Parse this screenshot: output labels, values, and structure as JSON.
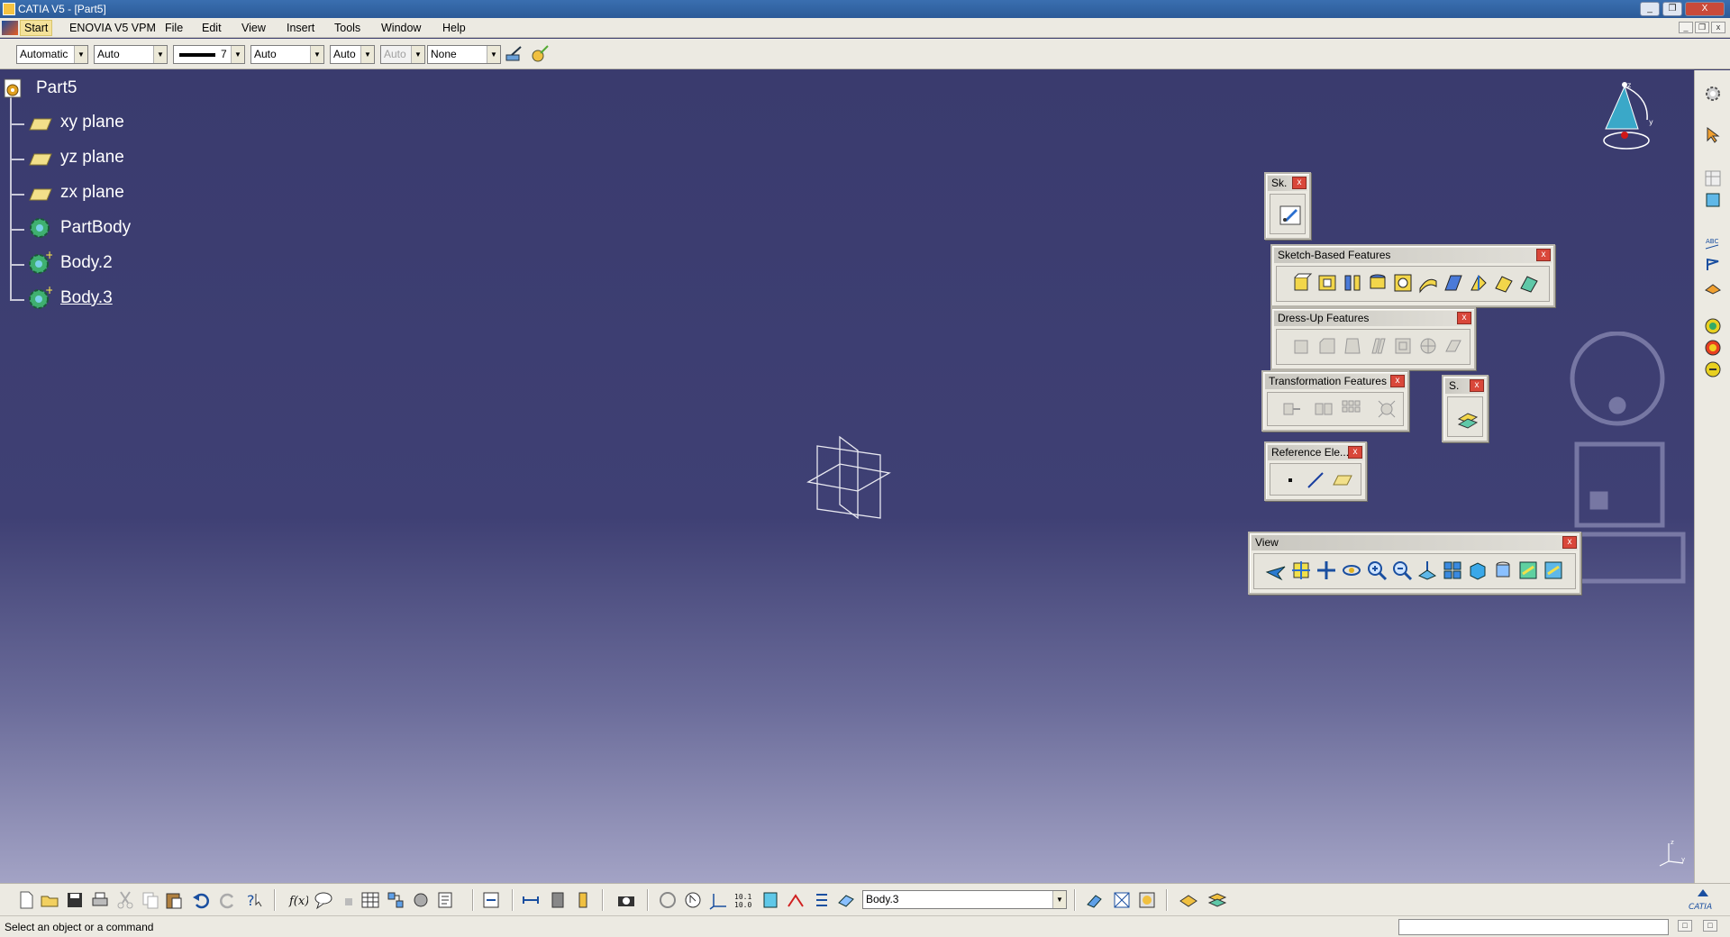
{
  "window": {
    "title": "CATIA V5 - [Part5]",
    "controls": {
      "minimize": "_",
      "restore": "❐",
      "close": "X"
    }
  },
  "menu": {
    "items": [
      "Start",
      "ENOVIA V5 VPM",
      "File",
      "Edit",
      "View",
      "Insert",
      "Tools",
      "Window",
      "Help"
    ]
  },
  "properties_toolbar": {
    "color": "Automatic",
    "transparency": "Auto",
    "line_thickness": "7",
    "line_type": "Auto",
    "point_symbol": "Auto",
    "render_style": "Auto",
    "layer": "None"
  },
  "spec_tree": {
    "root": "Part5",
    "nodes": [
      {
        "label": "xy plane",
        "type": "plane"
      },
      {
        "label": "yz plane",
        "type": "plane"
      },
      {
        "label": "zx plane",
        "type": "plane"
      },
      {
        "label": "PartBody",
        "type": "body"
      },
      {
        "label": "Body.2",
        "type": "body"
      },
      {
        "label": "Body.3",
        "type": "body"
      }
    ]
  },
  "floating_toolbars": {
    "sketcher": "Sk.",
    "sketch_based": "Sketch-Based Features",
    "dress_up": "Dress-Up Features",
    "transformation": "Transformation Features",
    "surface": "S.",
    "reference": "Reference Ele...",
    "view": "View"
  },
  "bottom_toolbar": {
    "current_body": "Body.3"
  },
  "status": {
    "message": "Select an object or a command"
  },
  "colors": {
    "viewport_top": "#3a3b6e",
    "viewport_bottom": "#a3a3c5",
    "toolbar_bg": "#eceae2",
    "titlebar": "#2b5a98",
    "close_red": "#d9473a"
  }
}
